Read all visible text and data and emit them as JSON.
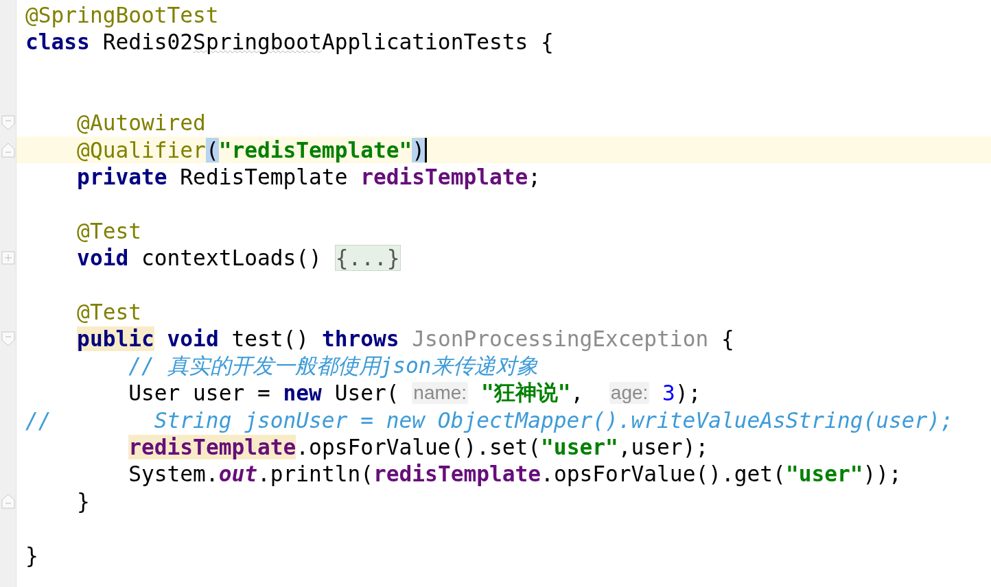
{
  "editor": {
    "lines": [
      {
        "kind": "code",
        "tokens": [
          {
            "text": "@SpringBootTest",
            "kind": "annotation"
          }
        ]
      },
      {
        "kind": "code",
        "tokens": [
          {
            "text": "class",
            "kind": "keyword"
          },
          {
            "text": " Redis02",
            "kind": "plain"
          },
          {
            "text": "Springboot",
            "kind": "typo"
          },
          {
            "text": "ApplicationTests {",
            "kind": "plain"
          }
        ]
      },
      {
        "kind": "blank"
      },
      {
        "kind": "blank"
      },
      {
        "kind": "code",
        "fold_marker": {
          "kind": "start"
        },
        "tokens": [
          {
            "text": "    @Autowired",
            "kind": "annotation"
          }
        ]
      },
      {
        "kind": "code",
        "fold_marker": {
          "kind": "end"
        },
        "current": true,
        "caret": true,
        "tokens": [
          {
            "text": "    @Qualifier",
            "kind": "annotation"
          },
          {
            "text": "(",
            "kind": "plain",
            "matched_brace": true
          },
          {
            "text": "\"redisTemplate\"",
            "kind": "string"
          },
          {
            "text": ")",
            "kind": "plain",
            "matched_brace": true
          }
        ]
      },
      {
        "kind": "code",
        "tokens": [
          {
            "text": "    private",
            "kind": "keyword"
          },
          {
            "text": " RedisTemplate ",
            "kind": "plain"
          },
          {
            "text": "redisTemplate",
            "kind": "field"
          },
          {
            "text": ";",
            "kind": "plain"
          }
        ]
      },
      {
        "kind": "blank"
      },
      {
        "kind": "code",
        "tokens": [
          {
            "text": "    @Test",
            "kind": "annotation"
          }
        ]
      },
      {
        "kind": "code",
        "fold_marker": {
          "kind": "collapsed"
        },
        "tokens": [
          {
            "text": "    void",
            "kind": "keyword"
          },
          {
            "text": " contextLoads() ",
            "kind": "plain"
          },
          {
            "text": "{...}",
            "kind": "plain",
            "folded": true
          }
        ]
      },
      {
        "kind": "blank"
      },
      {
        "kind": "code",
        "tokens": [
          {
            "text": "    @Test",
            "kind": "annotation"
          }
        ]
      },
      {
        "kind": "code",
        "fold_marker": {
          "kind": "start"
        },
        "tokens": [
          {
            "text": "    public",
            "kind": "keyword",
            "usage_highlight": true
          },
          {
            "text": " void",
            "kind": "keyword"
          },
          {
            "text": " test() ",
            "kind": "plain"
          },
          {
            "text": "throws",
            "kind": "keyword"
          },
          {
            "text": " JsonProcessingException",
            "kind": "unused"
          },
          {
            "text": " {",
            "kind": "plain"
          }
        ]
      },
      {
        "kind": "code",
        "tokens": [
          {
            "text": "        // 真实的开发一般都使用json来传递对象",
            "kind": "comment"
          }
        ]
      },
      {
        "kind": "code",
        "tokens": [
          {
            "text": "        User user = ",
            "kind": "plain"
          },
          {
            "text": "new",
            "kind": "keyword"
          },
          {
            "text": " User( ",
            "kind": "plain"
          },
          {
            "text": "name:",
            "kind": "hint"
          },
          {
            "text": " \"狂神说\"",
            "kind": "string"
          },
          {
            "text": ",  ",
            "kind": "plain"
          },
          {
            "text": "age:",
            "kind": "hint"
          },
          {
            "text": " 3",
            "kind": "number"
          },
          {
            "text": ");",
            "kind": "plain"
          }
        ]
      },
      {
        "kind": "code",
        "tokens": [
          {
            "text": "//        String jsonUser = new ObjectMapper().writeValueAsString(user);",
            "kind": "comment"
          }
        ]
      },
      {
        "kind": "code",
        "tokens": [
          {
            "text": "        redisTemplate",
            "kind": "field",
            "usage_highlight": true
          },
          {
            "text": ".opsForValue().set(",
            "kind": "plain"
          },
          {
            "text": "\"user\"",
            "kind": "string"
          },
          {
            "text": ",user);",
            "kind": "plain"
          }
        ]
      },
      {
        "kind": "code",
        "tokens": [
          {
            "text": "        System.",
            "kind": "plain"
          },
          {
            "text": "out",
            "kind": "static"
          },
          {
            "text": ".println(",
            "kind": "plain"
          },
          {
            "text": "redisTemplate",
            "kind": "field"
          },
          {
            "text": ".opsForValue().get(",
            "kind": "plain"
          },
          {
            "text": "\"user\"",
            "kind": "string"
          },
          {
            "text": "));",
            "kind": "plain"
          }
        ]
      },
      {
        "kind": "code",
        "fold_marker": {
          "kind": "end"
        },
        "tokens": [
          {
            "text": "    }",
            "kind": "plain"
          }
        ]
      },
      {
        "kind": "blank"
      },
      {
        "kind": "code",
        "tokens": [
          {
            "text": "}",
            "kind": "plain"
          }
        ]
      }
    ]
  }
}
